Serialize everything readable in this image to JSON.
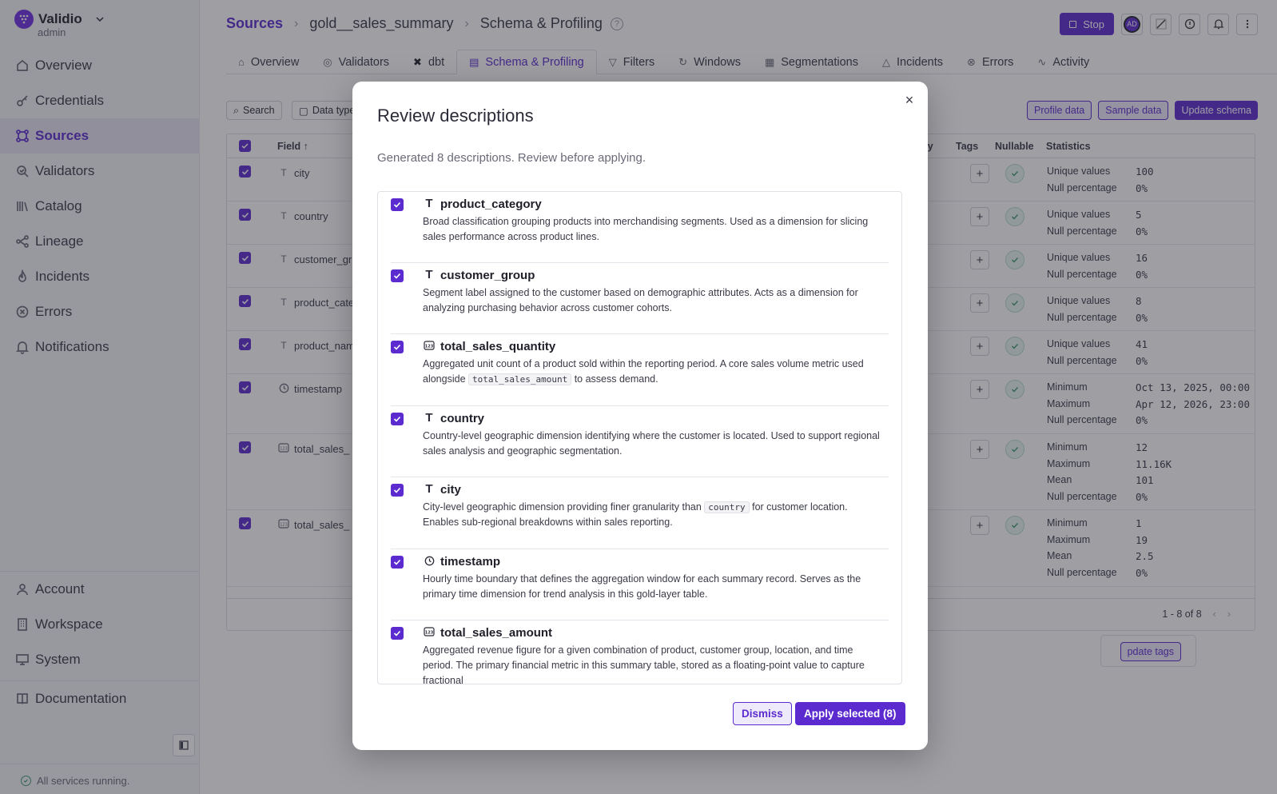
{
  "app": {
    "name": "Validio",
    "role": "admin",
    "accent": "#5b2bd0"
  },
  "sidebar": {
    "items": [
      {
        "label": "Overview",
        "icon": "home-icon"
      },
      {
        "label": "Credentials",
        "icon": "key-icon"
      },
      {
        "label": "Sources",
        "icon": "sources-icon",
        "active": true
      },
      {
        "label": "Validators",
        "icon": "validator-icon"
      },
      {
        "label": "Catalog",
        "icon": "catalog-icon"
      },
      {
        "label": "Lineage",
        "icon": "lineage-icon"
      },
      {
        "label": "Incidents",
        "icon": "flame-icon"
      },
      {
        "label": "Errors",
        "icon": "error-icon"
      },
      {
        "label": "Notifications",
        "icon": "bell-icon"
      }
    ],
    "bottom": [
      {
        "label": "Account",
        "icon": "user-icon"
      },
      {
        "label": "Workspace",
        "icon": "building-icon"
      },
      {
        "label": "System",
        "icon": "monitor-icon"
      }
    ],
    "documentation": "Documentation",
    "status": "All services running."
  },
  "header": {
    "breadcrumb": [
      "Sources",
      "gold__sales_summary",
      "Schema & Profiling"
    ],
    "stop_label": "Stop",
    "avatar": "AD"
  },
  "tabs": [
    {
      "label": "Overview",
      "icon": "home-icon"
    },
    {
      "label": "Validators",
      "icon": "validator-icon"
    },
    {
      "label": "dbt",
      "icon": "dbt-icon"
    },
    {
      "label": "Schema & Profiling",
      "icon": "schema-icon",
      "active": true
    },
    {
      "label": "Filters",
      "icon": "filter-icon"
    },
    {
      "label": "Windows",
      "icon": "window-icon"
    },
    {
      "label": "Segmentations",
      "icon": "segment-icon"
    },
    {
      "label": "Incidents",
      "icon": "warning-icon"
    },
    {
      "label": "Errors",
      "icon": "error-icon"
    },
    {
      "label": "Activity",
      "icon": "activity-icon"
    }
  ],
  "toolbar": {
    "search": "Search",
    "data_type": "Data type",
    "profile": "Profile data",
    "sample": "Sample data",
    "update_schema": "Update schema"
  },
  "table": {
    "headers": {
      "field": "Field",
      "glossary": "sary",
      "tags": "Tags",
      "nullable": "Nullable",
      "statistics": "Statistics"
    },
    "rows": [
      {
        "name": "city",
        "type": "T",
        "stats": [
          [
            "Unique values",
            "100"
          ],
          [
            "Null percentage",
            "0%"
          ]
        ]
      },
      {
        "name": "country",
        "type": "T",
        "stats": [
          [
            "Unique values",
            "5"
          ],
          [
            "Null percentage",
            "0%"
          ]
        ]
      },
      {
        "name": "customer_gr",
        "type": "T",
        "stats": [
          [
            "Unique values",
            "16"
          ],
          [
            "Null percentage",
            "0%"
          ]
        ]
      },
      {
        "name": "product_cate",
        "type": "T",
        "stats": [
          [
            "Unique values",
            "8"
          ],
          [
            "Null percentage",
            "0%"
          ]
        ]
      },
      {
        "name": "product_nam",
        "type": "T",
        "stats": [
          [
            "Unique values",
            "41"
          ],
          [
            "Null percentage",
            "0%"
          ]
        ]
      },
      {
        "name": "timestamp",
        "type": "clock",
        "stats": [
          [
            "Minimum",
            "Oct 13, 2025, 00:00"
          ],
          [
            "Maximum",
            "Apr 12, 2026, 23:00"
          ],
          [
            "Null percentage",
            "0%"
          ]
        ]
      },
      {
        "name": "total_sales_",
        "type": "num",
        "stats": [
          [
            "Minimum",
            "12"
          ],
          [
            "Maximum",
            "11.16K"
          ],
          [
            "Mean",
            "101"
          ],
          [
            "Null percentage",
            "0%"
          ]
        ]
      },
      {
        "name": "total_sales_",
        "type": "num",
        "stats": [
          [
            "Minimum",
            "1"
          ],
          [
            "Maximum",
            "19"
          ],
          [
            "Mean",
            "2.5"
          ],
          [
            "Null percentage",
            "0%"
          ]
        ]
      }
    ],
    "pager": "1 - 8 of 8",
    "update_tags": "pdate tags"
  },
  "modal": {
    "title": "Review descriptions",
    "subtitle": "Generated 8 descriptions. Review before applying.",
    "items": [
      {
        "name": "product_category",
        "type": "T",
        "desc_a": "Broad classification grouping products into merchandising segments. Used as a dimension for slicing sales performance across product lines.",
        "code": "",
        "desc_b": ""
      },
      {
        "name": "customer_group",
        "type": "T",
        "desc_a": "Segment label assigned to the customer based on demographic attributes. Acts as a dimension for analyzing purchasing behavior across customer cohorts.",
        "code": "",
        "desc_b": ""
      },
      {
        "name": "total_sales_quantity",
        "type": "num",
        "desc_a": "Aggregated unit count of a product sold within the reporting period. A core sales volume metric used alongside ",
        "code": "total_sales_amount",
        "desc_b": " to assess demand."
      },
      {
        "name": "country",
        "type": "T",
        "desc_a": "Country-level geographic dimension identifying where the customer is located. Used to support regional sales analysis and geographic segmentation.",
        "code": "",
        "desc_b": ""
      },
      {
        "name": "city",
        "type": "T",
        "desc_a": "City-level geographic dimension providing finer granularity than ",
        "code": "country",
        "desc_b": " for customer location. Enables sub-regional breakdowns within sales reporting."
      },
      {
        "name": "timestamp",
        "type": "clock",
        "desc_a": "Hourly time boundary that defines the aggregation window for each summary record. Serves as the primary time dimension for trend analysis in this gold-layer table.",
        "code": "",
        "desc_b": ""
      },
      {
        "name": "total_sales_amount",
        "type": "num",
        "desc_a": "Aggregated revenue figure for a given combination of product, customer group, location, and time period. The primary financial metric in this summary table, stored as a floating-point value to capture fractional",
        "code": "",
        "desc_b": ""
      }
    ],
    "dismiss": "Dismiss",
    "apply": "Apply selected (8)"
  }
}
